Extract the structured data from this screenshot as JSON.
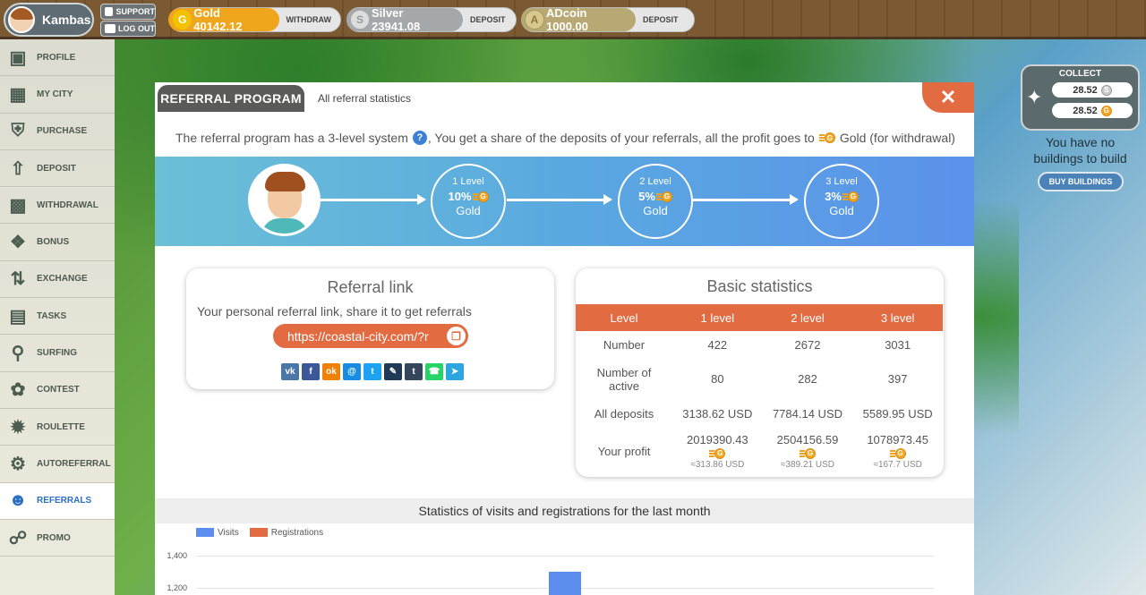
{
  "header": {
    "username": "Kambas",
    "support_label": "SUPPORT",
    "logout_label": "LOG OUT",
    "gold": {
      "label": "Gold 40142.12",
      "action": "WITHDRAW"
    },
    "silver": {
      "label": "Silver 23941.08",
      "action": "DEPOSIT"
    },
    "adcoin": {
      "label": "ADcoin 1000.00",
      "action": "DEPOSIT"
    }
  },
  "sidebar": {
    "items": [
      {
        "label": "PROFILE",
        "icon": "profile-icon"
      },
      {
        "label": "MY CITY",
        "icon": "city-icon"
      },
      {
        "label": "PURCHASE",
        "icon": "cart-icon"
      },
      {
        "label": "DEPOSIT",
        "icon": "deposit-icon"
      },
      {
        "label": "WITHDRAWAL",
        "icon": "withdrawal-icon"
      },
      {
        "label": "BONUS",
        "icon": "gift-icon"
      },
      {
        "label": "EXCHANGE",
        "icon": "exchange-icon"
      },
      {
        "label": "TASKS",
        "icon": "briefcase-icon"
      },
      {
        "label": "SURFING",
        "icon": "search-icon"
      },
      {
        "label": "CONTEST",
        "icon": "laurel-icon"
      },
      {
        "label": "ROULETTE",
        "icon": "roulette-icon"
      },
      {
        "label": "AUTOREFERRAL",
        "icon": "user-gear-icon"
      },
      {
        "label": "REFERRALS",
        "icon": "users-icon"
      },
      {
        "label": "PROMO",
        "icon": "share-icon"
      }
    ],
    "active": "REFERRALS"
  },
  "collect": {
    "title": "COLLECT",
    "silver_amount": "28.52",
    "gold_amount": "28.52",
    "no_buildings": "You have no buildings to build",
    "buy_label": "BUY BUILDINGS"
  },
  "modal": {
    "tab_active": "REFERRAL PROGRAM",
    "tab_other": "All referral statistics",
    "intro_part1": "The referral program has a 3-level system",
    "intro_part2": ", You get a share of the deposits of your referrals, all the profit goes to",
    "intro_part3": "Gold (for withdrawal)",
    "levels": [
      {
        "title": "1 Level",
        "percent": "10%",
        "currency": "Gold"
      },
      {
        "title": "2 Level",
        "percent": "5%",
        "currency": "Gold"
      },
      {
        "title": "3 Level",
        "percent": "3%",
        "currency": "Gold"
      }
    ],
    "referral_link": {
      "title": "Referral link",
      "text": "Your personal referral link, share it to get referrals",
      "url": "https://coastal-city.com/?r"
    },
    "basic_stats": {
      "title": "Basic statistics",
      "headers": [
        "Level",
        "1 level",
        "2 level",
        "3 level"
      ],
      "rows": [
        {
          "label": "Number",
          "values": [
            "422",
            "2672",
            "3031"
          ]
        },
        {
          "label": "Number of active",
          "values": [
            "80",
            "282",
            "397"
          ]
        },
        {
          "label": "All deposits",
          "values": [
            "3138.62 USD",
            "7784.14 USD",
            "5589.95 USD"
          ]
        }
      ],
      "profit_label": "Your profit",
      "profit": [
        {
          "amount": "2019390.43",
          "usd": "≈313.86 USD"
        },
        {
          "amount": "2504156.59",
          "usd": "≈389.21 USD"
        },
        {
          "amount": "1078973.45",
          "usd": "≈167.7 USD"
        }
      ]
    },
    "chart_title": "Statistics of visits and registrations for the last month"
  },
  "chart_data": {
    "type": "bar",
    "title": "Statistics of visits and registrations for the last month",
    "series": [
      {
        "name": "Visits",
        "color": "#5b8def"
      },
      {
        "name": "Registrations",
        "color": "#e36b42"
      }
    ],
    "yticks": [
      "1,400",
      "1,200"
    ],
    "visible_bars": [
      {
        "series": "Visits",
        "value": 1300
      }
    ]
  },
  "colors": {
    "accent": "#e36b42",
    "gold": "#f5a623",
    "blue": "#5b8def"
  }
}
